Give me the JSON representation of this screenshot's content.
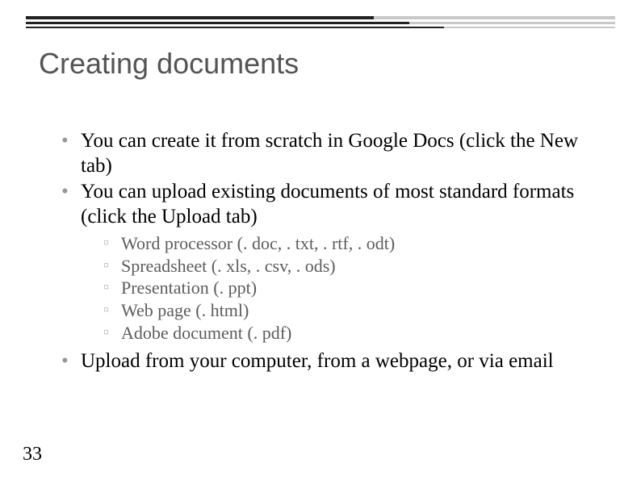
{
  "slide": {
    "title": "Creating documents",
    "bullets": [
      {
        "text": "You can create it from scratch in Google Docs (click the New tab)"
      },
      {
        "text": "You can upload existing documents of most standard formats (click the Upload tab)",
        "sub": [
          "Word processor (. doc, . txt, . rtf, . odt)",
          "Spreadsheet (. xls, . csv, . ods)",
          "Presentation (. ppt)",
          "Web page (. html)",
          "Adobe document (. pdf)"
        ]
      },
      {
        "text": "Upload from your computer, from a webpage, or via email"
      }
    ],
    "page_number": "33"
  }
}
